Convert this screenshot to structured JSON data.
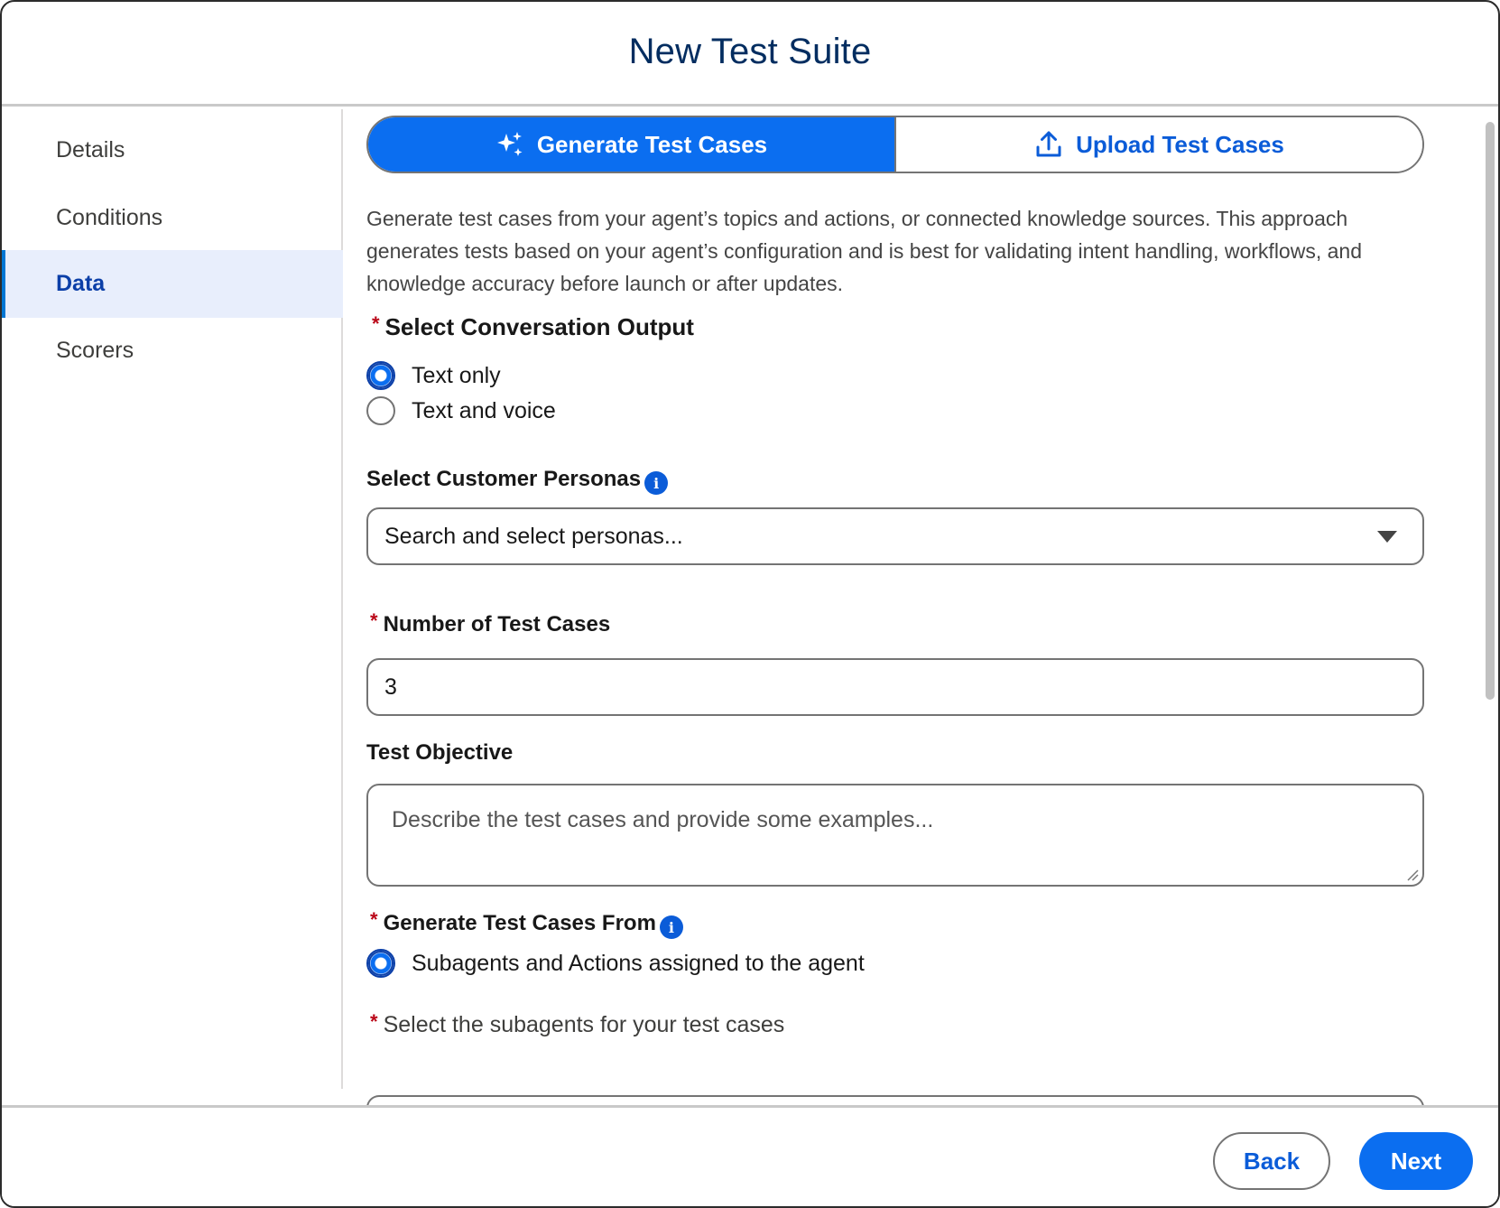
{
  "header": {
    "title": "New Test Suite"
  },
  "sidebar": {
    "items": [
      {
        "label": "Details"
      },
      {
        "label": "Conditions"
      },
      {
        "label": "Data"
      },
      {
        "label": "Scorers"
      }
    ],
    "active": "Data"
  },
  "tabs": {
    "generate_label": "Generate Test Cases",
    "upload_label": "Upload Test Cases",
    "generate_icon": "sparkle-icon",
    "upload_icon": "upload-icon"
  },
  "description": "Generate test cases from your agent’s topics and actions, or connected knowledge sources. This approach generates tests based on your agent’s configuration and is best for validating intent handling, workflows, and knowledge accuracy before launch or after updates.",
  "conversation_output": {
    "label": "Select Conversation Output",
    "required_mark": "*",
    "options": [
      {
        "label": "Text only",
        "selected": true
      },
      {
        "label": "Text and voice",
        "selected": false
      }
    ]
  },
  "personas": {
    "label": "Select Customer Personas",
    "placeholder": "Search and select personas..."
  },
  "num_test_cases": {
    "label": "Number of Test Cases",
    "required_mark": "*",
    "value": "3"
  },
  "test_objective": {
    "label": "Test Objective",
    "placeholder": "Describe the test cases and provide some examples..."
  },
  "generate_from": {
    "label": "Generate Test Cases From",
    "required_mark": "*",
    "options": [
      {
        "label": "Subagents and Actions assigned to the agent",
        "selected": true
      }
    ]
  },
  "subagents": {
    "label": "Select the subagents for your test cases",
    "required_mark": "*"
  },
  "footer": {
    "back_label": "Back",
    "next_label": "Next"
  },
  "colors": {
    "brand_blue": "#0b6ef0",
    "link_blue": "#0b5cd8",
    "title_navy": "#032d60",
    "required_red": "#ba0517"
  }
}
